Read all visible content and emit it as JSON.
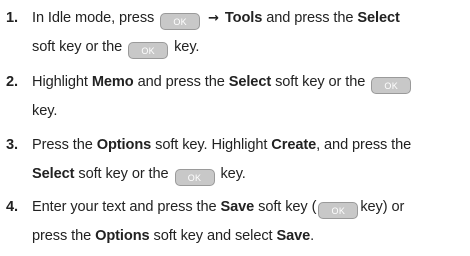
{
  "steps": [
    {
      "number": "1.",
      "line1": {
        "t1": "In Idle mode, press",
        "key": "OK",
        "arrow": "→",
        "b1": "Tools",
        "t2": "and press the",
        "b2": "Select"
      },
      "line2": {
        "t1": "soft key or the",
        "key": "OK",
        "t2": "key."
      }
    },
    {
      "number": "2.",
      "line1": {
        "t1": "Highlight",
        "b1": "Memo",
        "t2": "and press the",
        "b2": "Select",
        "t3": "soft key or the",
        "key": "OK"
      },
      "line2": {
        "t1": "key."
      }
    },
    {
      "number": "3.",
      "line1": {
        "t1": "Press the",
        "b1": "Options",
        "t2": "soft key. Highlight",
        "b2": "Create",
        "t3": ", and press the"
      },
      "line2": {
        "b1": "Select",
        "t1": "soft key or the",
        "key": "OK",
        "t2": "key."
      }
    },
    {
      "number": "4.",
      "line1": {
        "t1": "Enter your text and press the",
        "b1": "Save",
        "t2": "soft key (",
        "key": "OK",
        "t3": "key) or"
      },
      "line2": {
        "t1": "press the",
        "b1": "Options",
        "t2": "soft key and select",
        "b2": "Save",
        "t3": "."
      }
    }
  ]
}
